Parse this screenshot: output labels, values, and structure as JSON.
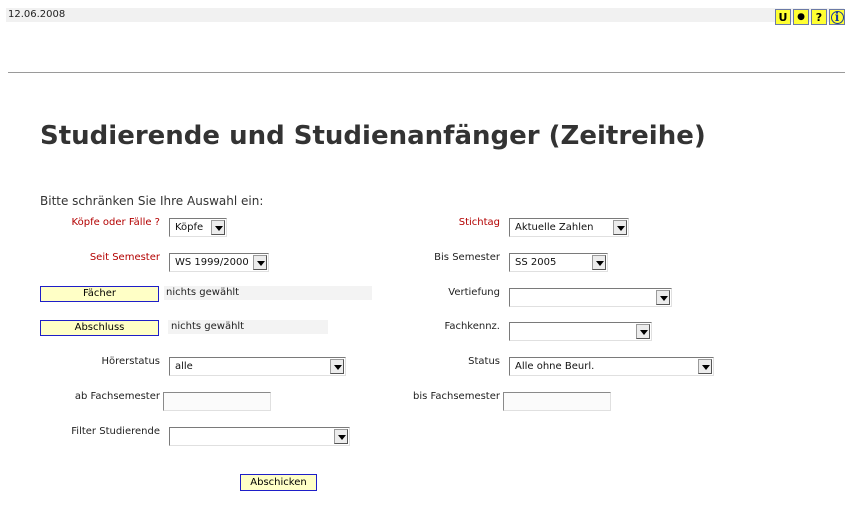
{
  "header": {
    "date": "12.06.2008",
    "icons": [
      {
        "name": "u-icon",
        "glyph": "U"
      },
      {
        "name": "dot-icon",
        "glyph": "●"
      },
      {
        "name": "help-icon",
        "glyph": "?"
      },
      {
        "name": "info-icon",
        "glyph": "i"
      }
    ]
  },
  "page": {
    "title": "Studierende und Studienanfänger (Zeitreihe)",
    "intro": "Bitte schränken Sie Ihre Auswahl ein:"
  },
  "form": {
    "koepfe_label": "Köpfe oder Fälle ?",
    "koepfe_value": "Köpfe",
    "stichtag_label": "Stichtag",
    "stichtag_value": "Aktuelle Zahlen",
    "seit_label": "Seit Semester",
    "seit_value": "WS 1999/2000",
    "bis_label": "Bis Semester",
    "bis_value": "SS 2005",
    "faecher_button": "Fächer",
    "faecher_value": "nichts gewählt",
    "vertiefung_label": "Vertiefung",
    "vertiefung_value": "",
    "abschluss_button": "Abschluss",
    "abschluss_value": "nichts gewählt",
    "fachkennz_label": "Fachkennz.",
    "fachkennz_value": "",
    "hoererstatus_label": "Hörerstatus",
    "hoererstatus_value": "alle",
    "status_label": "Status",
    "status_value": "Alle ohne Beurl.",
    "ab_fs_label": "ab Fachsemester",
    "ab_fs_value": "",
    "bis_fs_label": "bis Fachsemester",
    "bis_fs_value": "",
    "filter_label": "Filter Studierende",
    "filter_value": "",
    "submit_label": "Abschicken"
  },
  "colors": {
    "accent_label": "#b30000",
    "button_bg": "#ffffc6",
    "button_border": "#1e1ec8",
    "icon_bg": "#ffff33"
  }
}
